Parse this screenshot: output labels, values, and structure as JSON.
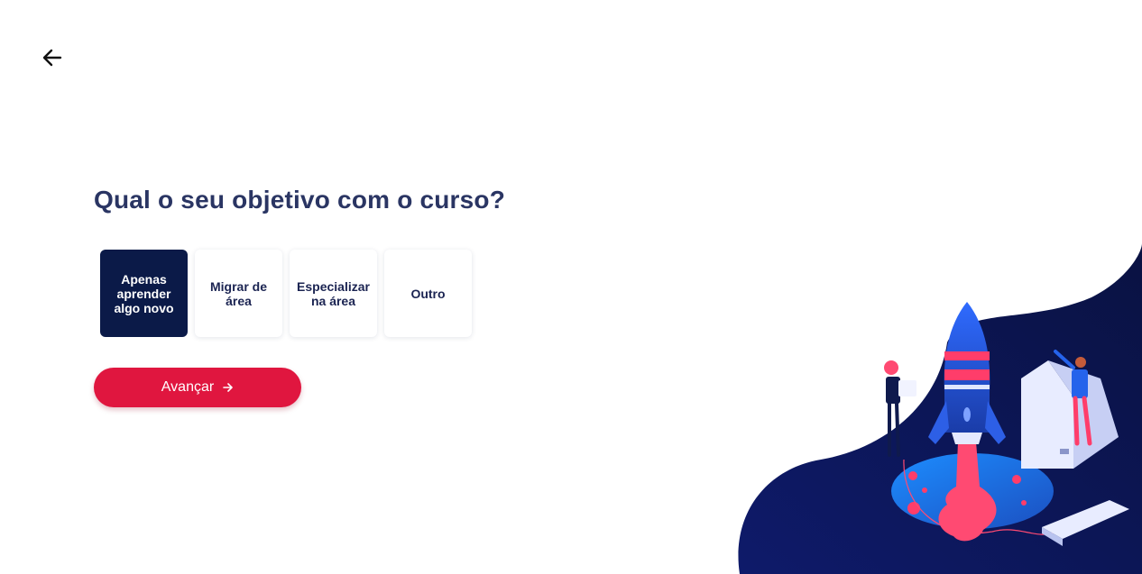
{
  "header": {
    "back_icon": "arrow-left-icon"
  },
  "question": {
    "title": "Qual o seu objetivo com o curso?"
  },
  "options": [
    {
      "label": "Apenas aprender algo novo",
      "selected": true
    },
    {
      "label": "Migrar de área",
      "selected": false
    },
    {
      "label": "Especializar na área",
      "selected": false
    },
    {
      "label": "Outro",
      "selected": false
    }
  ],
  "cta": {
    "label": "Avançar",
    "icon": "arrow-right-icon"
  },
  "illustration": {
    "name": "rocket-launch-illustration"
  },
  "colors": {
    "primary_dark": "#0b1a48",
    "accent": "#e0163f",
    "title": "#2a3563",
    "background": "#ffffff"
  }
}
